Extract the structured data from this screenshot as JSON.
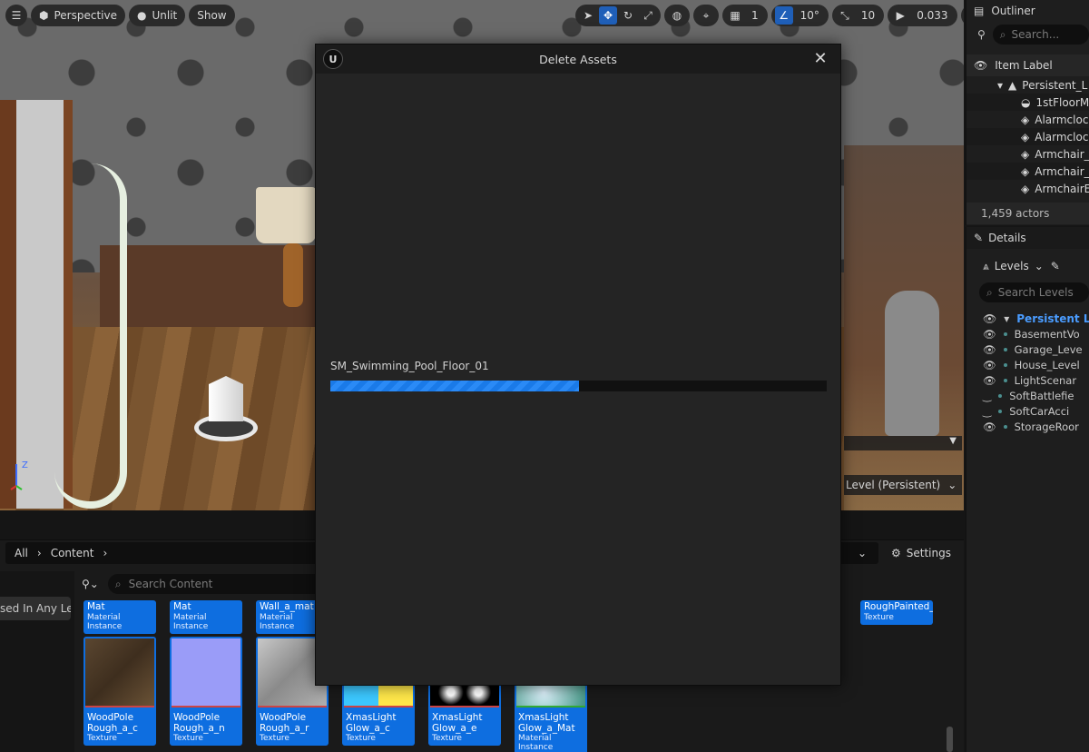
{
  "viewport": {
    "perspective_label": "Perspective",
    "unlit_label": "Unlit",
    "show_label": "Show",
    "grid_value": "1",
    "angle_value": "10°",
    "scale_value": "10",
    "camera_speed": "0.033",
    "level_label": "Level (Persistent)",
    "axis_label": "Z"
  },
  "outliner": {
    "title": "Outliner",
    "search_placeholder": "Search...",
    "column_label": "Item Label",
    "root": "Persistent_L",
    "items": [
      "1stFloorM",
      "Alarmcloc",
      "Alarmcloc",
      "Armchair_",
      "Armchair_",
      "ArmchairE"
    ],
    "actor_count": "1,459 actors"
  },
  "details": {
    "tab_label": "Details",
    "levels_label": "Levels",
    "search_placeholder": "Search Levels",
    "persistent_level": "Persistent Le",
    "levels": [
      "BasementVo",
      "Garage_Leve",
      "House_Level",
      "LightScenar",
      "SoftBattlefie",
      "SoftCarAcci",
      "StorageRoor"
    ]
  },
  "content_browser": {
    "breadcrumb": [
      "All",
      "Content"
    ],
    "settings_label": "Settings",
    "search_placeholder": "Search Content",
    "used_filter": "sed In Any Lev",
    "top_row": [
      {
        "name": "Mat",
        "type": "Material Instance"
      },
      {
        "name": "Mat",
        "type": "Material Instance"
      },
      {
        "name": "Wall_a_mat",
        "type": "Material Instance"
      },
      {
        "name": "RoughPainted_",
        "type": "Texture"
      }
    ],
    "bottom_row": [
      {
        "name": "WoodPole Rough_a_c",
        "type": "Texture"
      },
      {
        "name": "WoodPole Rough_a_n",
        "type": "Texture"
      },
      {
        "name": "WoodPole Rough_a_r",
        "type": "Texture"
      },
      {
        "name": "XmasLight Glow_a_c",
        "type": "Texture"
      },
      {
        "name": "XmasLight Glow_a_e",
        "type": "Texture"
      },
      {
        "name": "XmasLight Glow_a_Mat",
        "type": "Material Instance"
      }
    ]
  },
  "dialog": {
    "title": "Delete Assets",
    "current_asset": "SM_Swimming_Pool_Floor_01",
    "progress": 0.5
  },
  "colors": {
    "accent": "#0e6ee0",
    "persistent_level": "#4a9cff",
    "progress": "#1a7ae8"
  }
}
